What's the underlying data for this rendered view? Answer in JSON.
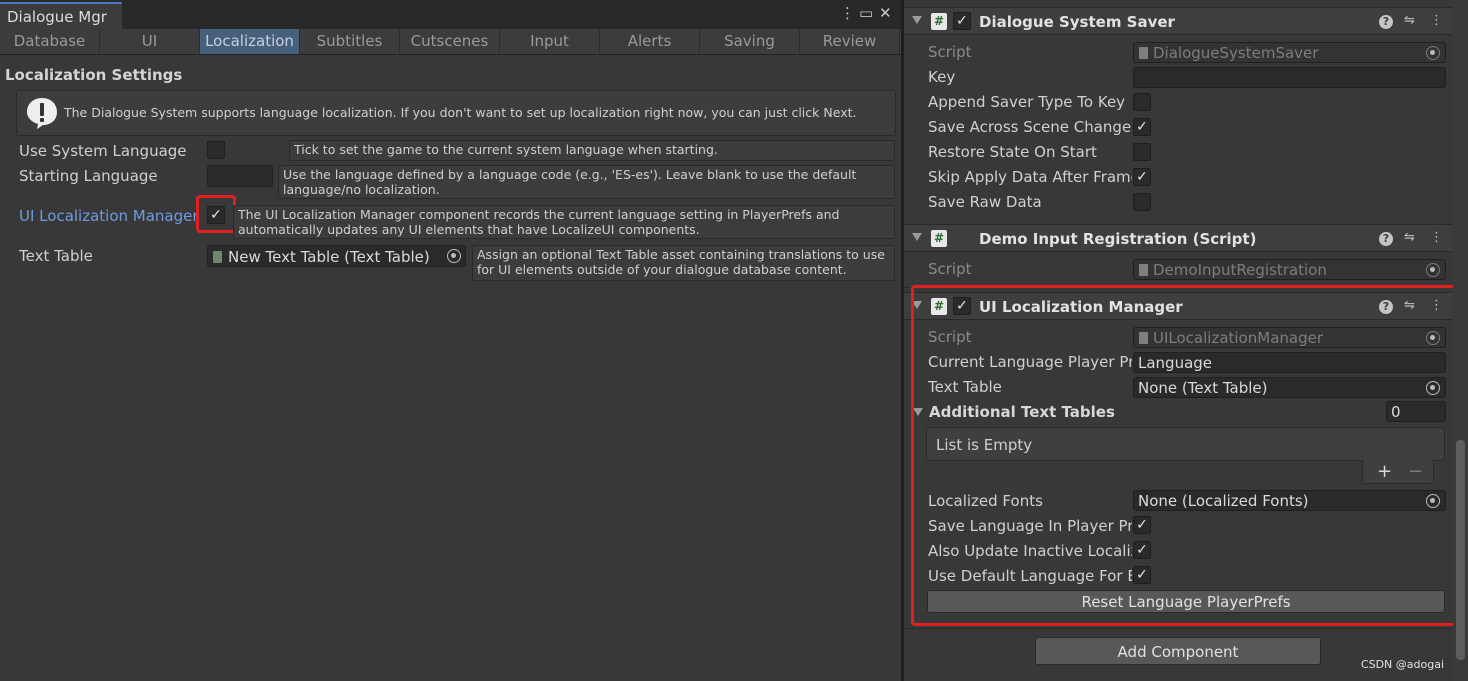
{
  "left_window": {
    "title": "Dialogue Mgr",
    "controls": {
      "menu": "⋮",
      "maximize": "▭",
      "close": "✕"
    },
    "tabs": [
      {
        "label": "Database"
      },
      {
        "label": "UI"
      },
      {
        "label": "Localization"
      },
      {
        "label": "Subtitles"
      },
      {
        "label": "Cutscenes"
      },
      {
        "label": "Input"
      },
      {
        "label": "Alerts"
      },
      {
        "label": "Saving"
      },
      {
        "label": "Review"
      }
    ],
    "active_tab": "Localization",
    "section_title": "Localization Settings",
    "help_text": "The Dialogue System supports language localization. If you don't want to set up localization right now, you can just click Next.",
    "rows": {
      "use_system_language": {
        "label": "Use System Language",
        "checked": false,
        "tip": "Tick to set the game to the current system language when starting."
      },
      "starting_language": {
        "label": "Starting Language",
        "value": "",
        "tip_line1": "Use the language defined by a language code (e.g., 'ES-es'). Leave blank to use the default",
        "tip_line2": "language/no localization."
      },
      "ui_localization_manager": {
        "label": "UI Localization Manager",
        "checked": true,
        "check_glyph": "✓",
        "tip_line1": "The UI Localization Manager component records the current language setting in PlayerPrefs and",
        "tip_line2": "automatically updates any UI elements that have LocalizeUI components."
      },
      "text_table": {
        "label": "Text Table",
        "value": "New Text Table (Text Table)",
        "tip_line1": "Assign an optional Text Table asset containing translations to use",
        "tip_line2": "for UI elements outside of your dialogue database content."
      }
    }
  },
  "inspector": {
    "saver": {
      "title": "Dialogue System Saver",
      "enabled": true,
      "script_label": "Script",
      "script_value": "DialogueSystemSaver",
      "fields": [
        {
          "label": "Key",
          "type": "text",
          "value": ""
        },
        {
          "label": "Append Saver Type To Key",
          "type": "bool",
          "checked": false
        },
        {
          "label": "Save Across Scene Changes",
          "type": "bool",
          "checked": true
        },
        {
          "label": "Restore State On Start",
          "type": "bool",
          "checked": false
        },
        {
          "label": "Skip Apply Data After Frame",
          "type": "bool",
          "checked": true
        },
        {
          "label": "Save Raw Data",
          "type": "bool",
          "checked": false
        }
      ]
    },
    "demo_input": {
      "title": "Demo Input Registration (Script)",
      "script_label": "Script",
      "script_value": "DemoInputRegistration"
    },
    "ui_loc_manager": {
      "title": "UI Localization Manager",
      "enabled": true,
      "script_label": "Script",
      "script_value": "UILocalizationManager",
      "current_language_label": "Current Language Player Prefs Key",
      "current_language_value": "Language",
      "text_table_label": "Text Table",
      "text_table_value": "None (Text Table)",
      "additional_tables_label": "Additional Text Tables",
      "additional_tables_count": "0",
      "list_empty": "List is Empty",
      "add_glyph": "+",
      "remove_glyph": "−",
      "localized_fonts_label": "Localized Fonts",
      "localized_fonts_value": "None (Localized Fonts)",
      "bools": [
        {
          "label": "Save Language In Player Prefs",
          "checked": true
        },
        {
          "label": "Also Update Inactive Localize UI",
          "checked": true
        },
        {
          "label": "Use Default Language For Blank Translations",
          "checked": true
        }
      ],
      "reset_button": "Reset Language PlayerPrefs"
    },
    "add_component": "Add Component",
    "watermark": "CSDN @adogai"
  },
  "colors": {
    "highlight_box": "#e02020",
    "active_tab": "#46607c",
    "link_label": "#6d9be0"
  }
}
